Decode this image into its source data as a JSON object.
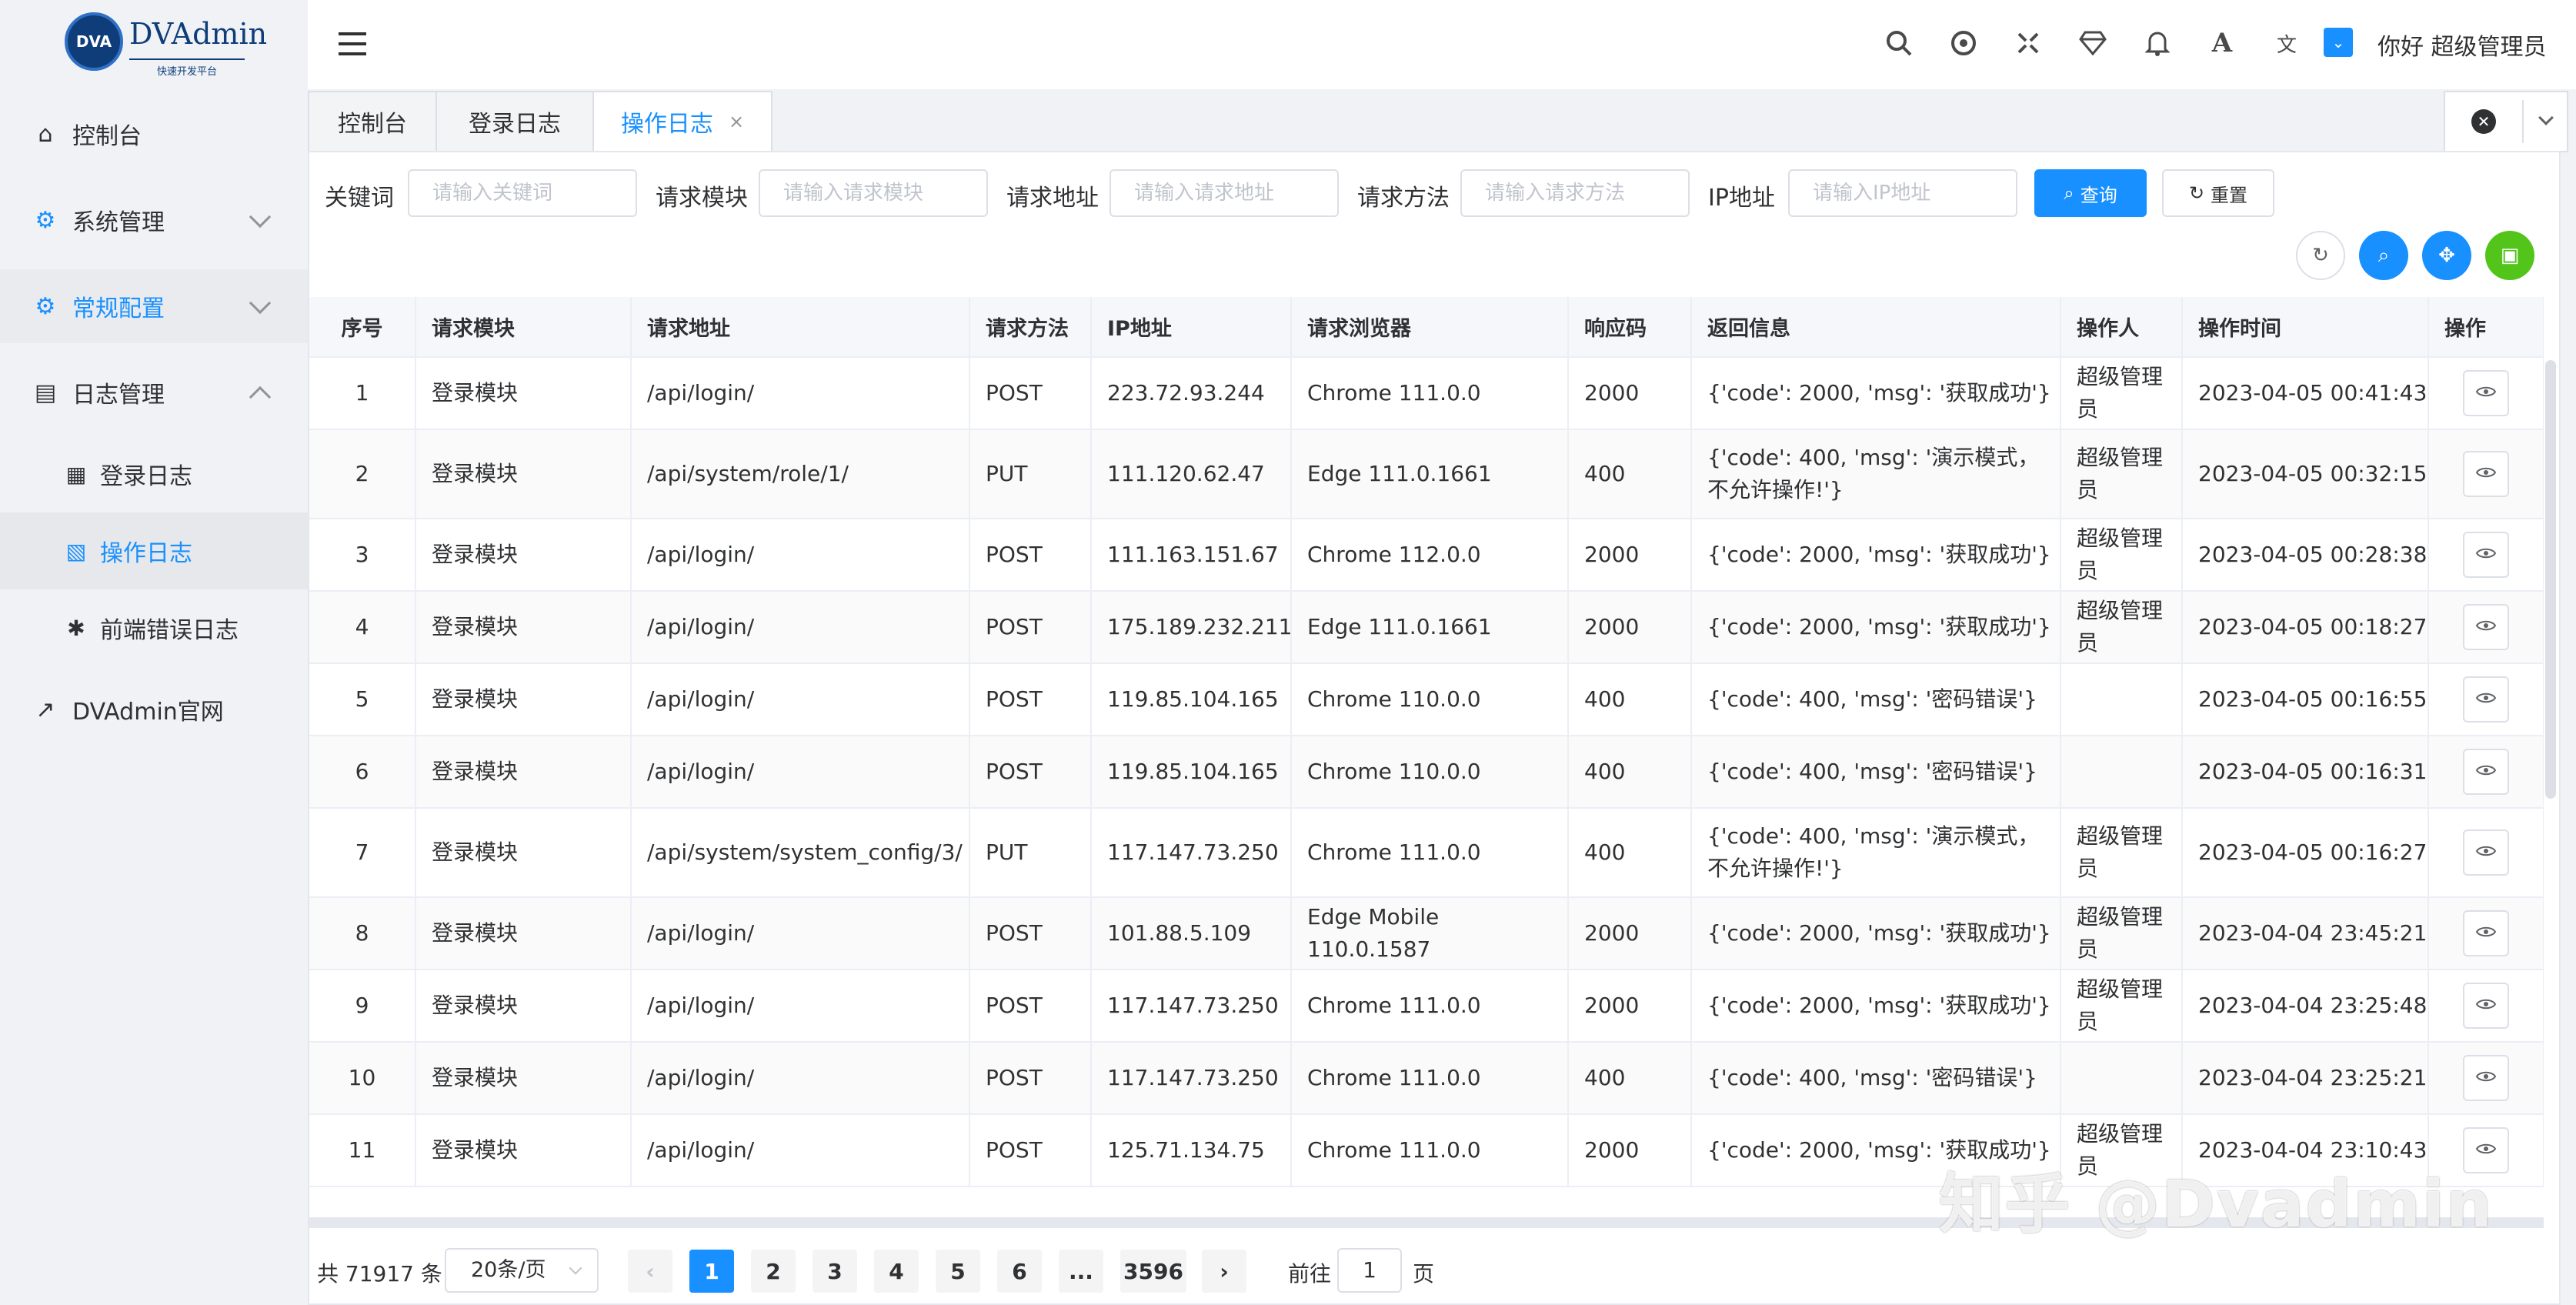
{
  "app": {
    "logo_mark": "DVA",
    "logo_title": "DVAdmin",
    "logo_subtitle": "快速开发平台"
  },
  "sidebar": {
    "items": [
      {
        "label": "控制台",
        "icon": "home-icon"
      },
      {
        "label": "系统管理",
        "icon": "gear-icon"
      },
      {
        "label": "常规配置",
        "icon": "gears-icon"
      },
      {
        "label": "日志管理",
        "icon": "book-icon"
      },
      {
        "label": "登录日志",
        "icon": "file-icon"
      },
      {
        "label": "操作日志",
        "icon": "file-code-icon"
      },
      {
        "label": "前端错误日志",
        "icon": "bug-icon"
      },
      {
        "label": "DVAdmin官网",
        "icon": "external-link-icon"
      }
    ]
  },
  "header": {
    "greeting": "你好 超级管理员"
  },
  "tabs": [
    {
      "label": "控制台"
    },
    {
      "label": "登录日志"
    },
    {
      "label": "操作日志",
      "close": "×"
    }
  ],
  "filters": {
    "keyword_label": "关键词",
    "keyword_placeholder": "请输入关键词",
    "module_label": "请求模块",
    "module_placeholder": "请输入请求模块",
    "url_label": "请求地址",
    "url_placeholder": "请输入请求地址",
    "method_label": "请求方法",
    "method_placeholder": "请输入请求方法",
    "ip_label": "IP地址",
    "ip_placeholder": "请输入IP地址",
    "search_label": "查询",
    "reset_label": "重置"
  },
  "table": {
    "columns": [
      "序号",
      "请求模块",
      "请求地址",
      "请求方法",
      "IP地址",
      "请求浏览器",
      "响应码",
      "返回信息",
      "操作人",
      "操作时间",
      "操作"
    ],
    "rows": [
      [
        "1",
        "登录模块",
        "/api/login/",
        "POST",
        "223.72.93.244",
        "Chrome 111.0.0",
        "2000",
        "{'code': 2000, 'msg': '获取成功'}",
        "超级管理员",
        "2023-04-05 00:41:43"
      ],
      [
        "2",
        "登录模块",
        "/api/system/role/1/",
        "PUT",
        "111.120.62.47",
        "Edge 111.0.1661",
        "400",
        "{'code': 400, 'msg': '演示模式，不允许操作!'}",
        "超级管理员",
        "2023-04-05 00:32:15"
      ],
      [
        "3",
        "登录模块",
        "/api/login/",
        "POST",
        "111.163.151.67",
        "Chrome 112.0.0",
        "2000",
        "{'code': 2000, 'msg': '获取成功'}",
        "超级管理员",
        "2023-04-05 00:28:38"
      ],
      [
        "4",
        "登录模块",
        "/api/login/",
        "POST",
        "175.189.232.211",
        "Edge 111.0.1661",
        "2000",
        "{'code': 2000, 'msg': '获取成功'}",
        "超级管理员",
        "2023-04-05 00:18:27"
      ],
      [
        "5",
        "登录模块",
        "/api/login/",
        "POST",
        "119.85.104.165",
        "Chrome 110.0.0",
        "400",
        "{'code': 400, 'msg': '密码错误'}",
        "",
        "2023-04-05 00:16:55"
      ],
      [
        "6",
        "登录模块",
        "/api/login/",
        "POST",
        "119.85.104.165",
        "Chrome 110.0.0",
        "400",
        "{'code': 400, 'msg': '密码错误'}",
        "",
        "2023-04-05 00:16:31"
      ],
      [
        "7",
        "登录模块",
        "/api/system/system_config/3/",
        "PUT",
        "117.147.73.250",
        "Chrome 111.0.0",
        "400",
        "{'code': 400, 'msg': '演示模式，不允许操作!'}",
        "超级管理员",
        "2023-04-05 00:16:27"
      ],
      [
        "8",
        "登录模块",
        "/api/login/",
        "POST",
        "101.88.5.109",
        "Edge Mobile 110.0.1587",
        "2000",
        "{'code': 2000, 'msg': '获取成功'}",
        "超级管理员",
        "2023-04-04 23:45:21"
      ],
      [
        "9",
        "登录模块",
        "/api/login/",
        "POST",
        "117.147.73.250",
        "Chrome 111.0.0",
        "2000",
        "{'code': 2000, 'msg': '获取成功'}",
        "超级管理员",
        "2023-04-04 23:25:48"
      ],
      [
        "10",
        "登录模块",
        "/api/login/",
        "POST",
        "117.147.73.250",
        "Chrome 111.0.0",
        "400",
        "{'code': 400, 'msg': '密码错误'}",
        "",
        "2023-04-04 23:25:21"
      ],
      [
        "11",
        "登录模块",
        "/api/login/",
        "POST",
        "125.71.134.75",
        "Chrome 111.0.0",
        "2000",
        "{'code': 2000, 'msg': '获取成功'}",
        "超级管理员",
        "2023-04-04 23:10:43"
      ]
    ]
  },
  "pagination": {
    "total": "共 71917 条",
    "page_size": "20条/页",
    "pages": [
      "1",
      "2",
      "3",
      "4",
      "5",
      "6",
      "...",
      "3596"
    ],
    "jump_prefix": "前往",
    "jump_value": "1",
    "jump_suffix": "页"
  },
  "watermark": "知乎 @Dvadmin",
  "colors": {
    "accent": "#1890ff",
    "success": "#52c41a"
  }
}
